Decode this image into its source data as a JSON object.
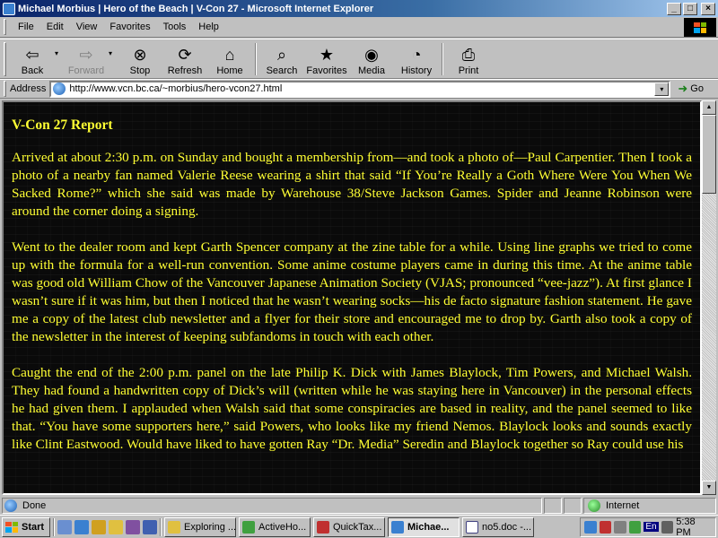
{
  "window": {
    "title": "Michael Morbius | Hero of the Beach | V-Con 27 - Microsoft Internet Explorer",
    "minimize": "_",
    "maximize": "□",
    "close": "×"
  },
  "menu": {
    "items": [
      {
        "key": "F",
        "rest": "ile"
      },
      {
        "key": "E",
        "rest": "dit"
      },
      {
        "key": "V",
        "rest": "iew"
      },
      {
        "key": "",
        "pre": "F",
        "rest": "avorites",
        "under": "a"
      },
      {
        "key": "T",
        "rest": "ools"
      },
      {
        "key": "H",
        "rest": "elp"
      }
    ],
    "labels": [
      "File",
      "Edit",
      "View",
      "Favorites",
      "Tools",
      "Help"
    ]
  },
  "toolbar": {
    "back": "Back",
    "forward": "Forward",
    "stop": "Stop",
    "refresh": "Refresh",
    "home": "Home",
    "search": "Search",
    "favorites": "Favorites",
    "media": "Media",
    "history": "History",
    "print": "Print",
    "dropdown_glyph": "▾"
  },
  "address": {
    "label": "Address",
    "value": "http://www.vcn.bc.ca/~morbius/hero-vcon27.html",
    "go": "Go"
  },
  "article": {
    "title": "V-Con 27 Report",
    "paragraphs": [
      "Arrived at about 2:30 p.m. on Sunday and bought a membership from—and took a photo of—Paul Carpentier. Then I took a photo of a nearby fan named Valerie Reese wearing a shirt that said “If You’re Really a Goth Where Were You When We Sacked Rome?” which she said was made by Warehouse 38/Steve Jackson Games. Spider and Jeanne Robinson were around the corner doing a signing.",
      "Went to the dealer room and kept Garth Spencer company at the zine table for a while. Using line graphs we tried to come up with the formula for a well-run convention. Some anime costume players came in during this time. At the anime table was good old William Chow of the Vancouver Japanese Animation Society (VJAS; pronounced “vee-jazz”). At first glance I wasn’t sure if it was him, but then I noticed that he wasn’t wearing socks—his de facto signature fashion statement. He gave me a copy of the latest club newsletter and a flyer for their store and encouraged me to drop by. Garth also took a copy of the newsletter in the interest of keeping subfandoms in touch with each other.",
      "Caught the end of the 2:00 p.m. panel on the late Philip K. Dick with James Blaylock, Tim Powers, and Michael Walsh. They had found a handwritten copy of Dick’s will (written while he was staying here in Vancouver) in the personal effects he had given them. I applauded when Walsh said that some conspiracies are based in reality, and the panel seemed to like that. “You have some supporters here,” said Powers, who looks like my friend Nemos. Blaylock looks and sounds exactly like Clint Eastwood. Would have liked to have gotten Ray “Dr. Media” Seredin and Blaylock together so Ray could use his"
    ]
  },
  "status": {
    "text": "Done",
    "zone": "Internet"
  },
  "taskbar": {
    "start": "Start",
    "tasks": [
      "Exploring ...",
      "ActiveHo...",
      "QuickTax...",
      "Michae...",
      "no5.doc -..."
    ],
    "active_index": 3,
    "lang": "En",
    "clock": "5:38 PM"
  },
  "colors": {
    "title_gradient_start": "#0a246a",
    "content_bg": "#0a0a0a",
    "content_text": "#ffff33",
    "chrome": "#c0c0c0"
  }
}
